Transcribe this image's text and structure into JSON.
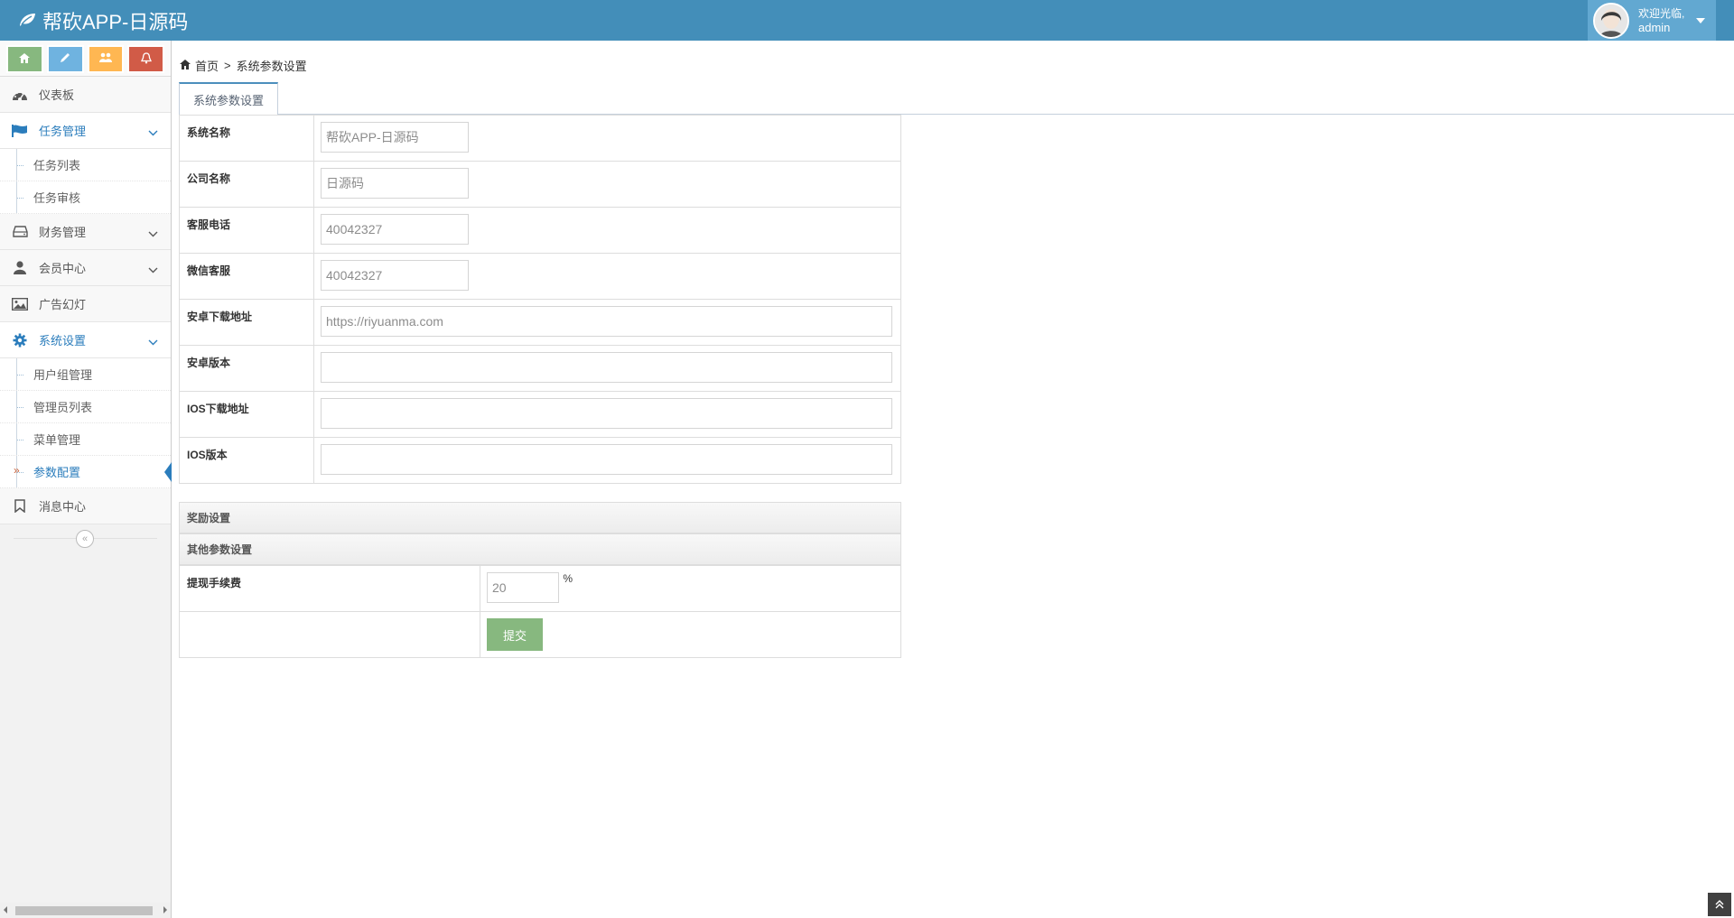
{
  "app": {
    "title": "帮砍APP-日源码"
  },
  "user": {
    "welcome": "欢迎光临,",
    "name": "admin"
  },
  "shortcuts": [
    "home-icon",
    "pencil-icon",
    "users-icon",
    "bell-icon"
  ],
  "sidebar": {
    "items": [
      {
        "label": "仪表板",
        "icon": "dashboard-icon"
      },
      {
        "label": "任务管理",
        "icon": "flag-icon",
        "open": true,
        "children": [
          "任务列表",
          "任务审核"
        ]
      },
      {
        "label": "财务管理",
        "icon": "hdd-icon"
      },
      {
        "label": "会员中心",
        "icon": "user-icon"
      },
      {
        "label": "广告幻灯",
        "icon": "picture-icon"
      },
      {
        "label": "系统设置",
        "icon": "cog-icon",
        "open": true,
        "children": [
          "用户组管理",
          "管理员列表",
          "菜单管理",
          "参数配置"
        ]
      },
      {
        "label": "消息中心",
        "icon": "bookmark-icon"
      }
    ],
    "active_child": "参数配置",
    "collapse_icon": "double-angle-left-icon"
  },
  "breadcrumb": {
    "home": "首页",
    "separator": ">",
    "current": "系统参数设置"
  },
  "tabs": [
    {
      "label": "系统参数设置",
      "active": true
    }
  ],
  "form": {
    "fields": [
      {
        "label": "系统名称",
        "value": "帮砍APP-日源码"
      },
      {
        "label": "公司名称",
        "value": "日源码"
      },
      {
        "label": "客服电话",
        "value": "40042327"
      },
      {
        "label": "微信客服",
        "value": "40042327"
      },
      {
        "label": "安卓下载地址",
        "value": "https://riyuanma.com"
      },
      {
        "label": "安卓版本",
        "value": ""
      },
      {
        "label": "IOS下载地址",
        "value": ""
      },
      {
        "label": "IOS版本",
        "value": ""
      }
    ],
    "sections": [
      "奖励设置",
      "其他参数设置"
    ],
    "withdraw_fee": {
      "label": "提现手续费",
      "value": "20",
      "unit": "%"
    },
    "submit_label": "提交"
  },
  "colors": {
    "navbar": "#438eb9",
    "accent": "#2b7dbc",
    "submit": "#87b87f"
  }
}
